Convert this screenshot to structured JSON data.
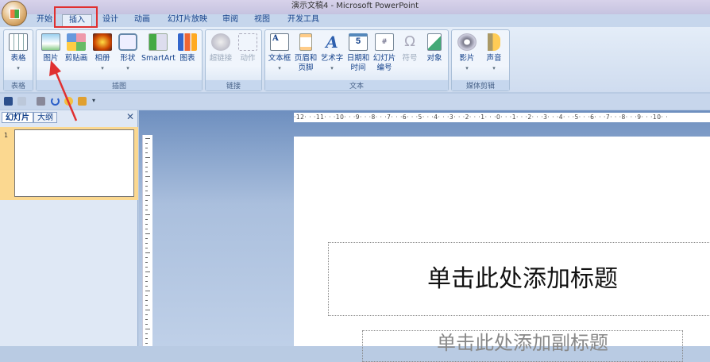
{
  "window": {
    "title": "演示文稿4 - Microsoft PowerPoint"
  },
  "tabs": [
    "开始",
    "插入",
    "设计",
    "动画",
    "幻灯片放映",
    "审阅",
    "视图",
    "开发工具"
  ],
  "active_tab": "插入",
  "ribbon": {
    "groups": [
      {
        "label": "表格",
        "buttons": [
          {
            "label": "表格",
            "dd": "▾"
          }
        ]
      },
      {
        "label": "插图",
        "buttons": [
          {
            "label": "图片"
          },
          {
            "label": "剪贴画"
          },
          {
            "label": "相册",
            "dd": "▾"
          },
          {
            "label": "形状",
            "dd": "▾"
          },
          {
            "label": "SmartArt"
          },
          {
            "label": "图表"
          }
        ]
      },
      {
        "label": "链接",
        "buttons": [
          {
            "label": "超链接"
          },
          {
            "label": "动作"
          }
        ]
      },
      {
        "label": "文本",
        "buttons": [
          {
            "label": "文本框",
            "dd": "▾"
          },
          {
            "label": "页眉和",
            "label2": "页脚"
          },
          {
            "label": "艺术字",
            "dd": "▾"
          },
          {
            "label": "日期和",
            "label2": "时间"
          },
          {
            "label": "幻灯片",
            "label2": "编号"
          },
          {
            "label": "符号"
          },
          {
            "label": "对象"
          }
        ]
      },
      {
        "label": "媒体剪辑",
        "buttons": [
          {
            "label": "影片",
            "dd": "▾"
          },
          {
            "label": "声音",
            "dd": "▾"
          }
        ]
      }
    ]
  },
  "pane": {
    "tabs": [
      "幻灯片",
      "大纲"
    ],
    "close": "✕",
    "slide_number": "1"
  },
  "ruler": {
    "horizontal": "·12· · ·11· · ·10· · ·9· · ·8· · ·7· · ·6· · ·5· · ·4· · ·3· · ·2· · ·1· · ·0· · ·1· · ·2· · ·3· · ·4· · ·5· · ·6· · ·7· · ·8· · ·9· · ·10· ·"
  },
  "slide": {
    "title_placeholder": "单击此处添加标题",
    "subtitle_placeholder": "单击此处添加副标题"
  },
  "colors": {
    "annotation": "#e03030",
    "accent": "#15428b"
  }
}
